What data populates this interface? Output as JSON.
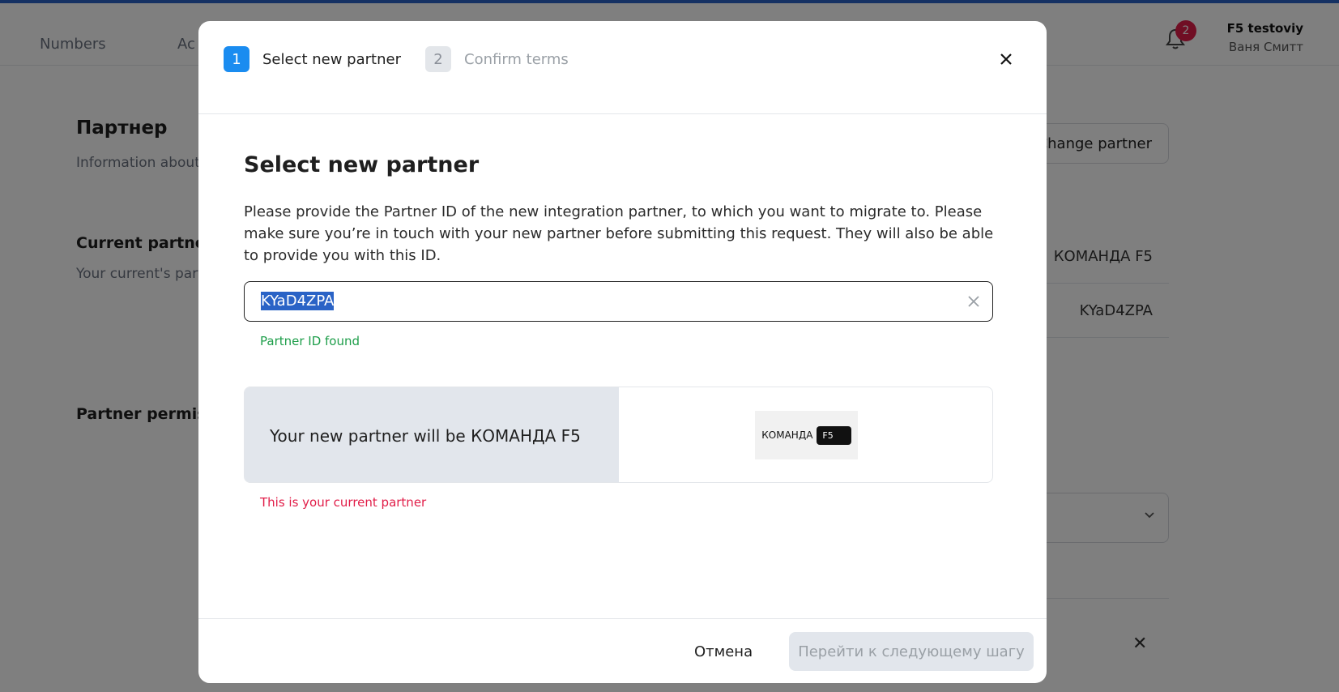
{
  "header": {
    "nav": [
      "Numbers",
      "Ac"
    ],
    "notifications_count": "2",
    "user_name": "F5 testoviy",
    "user_subtitle": "Ваня Смитт"
  },
  "page": {
    "title": "Партнер",
    "subtitle": "Information about",
    "change_partner_label": "Change partner",
    "current_partner_title": "Current partner",
    "current_partner_subtitle": "Your current's part",
    "current_partner_name": "КОМАНДА F5",
    "current_partner_id": "KYaD4ZPA",
    "permissions_title": "Partner permiss"
  },
  "modal": {
    "steps": [
      {
        "number": "1",
        "label": "Select new partner",
        "active": true
      },
      {
        "number": "2",
        "label": "Confirm terms",
        "active": false
      }
    ],
    "title": "Select new partner",
    "description": "Please provide the Partner ID of the new integration partner, to which you want to migrate to. Please make sure you’re in touch with your new partner before submitting this request. They will also be able to provide you with this ID.",
    "input_value": "KYaD4ZPA",
    "found_message": "Partner ID found",
    "partner_text": "Your new partner will be КОМАНДА F5",
    "logo_text": "КОМАНДА",
    "logo_chip": "F5",
    "error_message": "This is your current partner",
    "cancel_label": "Отмена",
    "next_label": "Перейти к следующему шагу"
  },
  "colors": {
    "accent": "#1a8cf0",
    "success": "#1e9e4a",
    "error": "#e11d48",
    "badge": "#e11d48"
  }
}
